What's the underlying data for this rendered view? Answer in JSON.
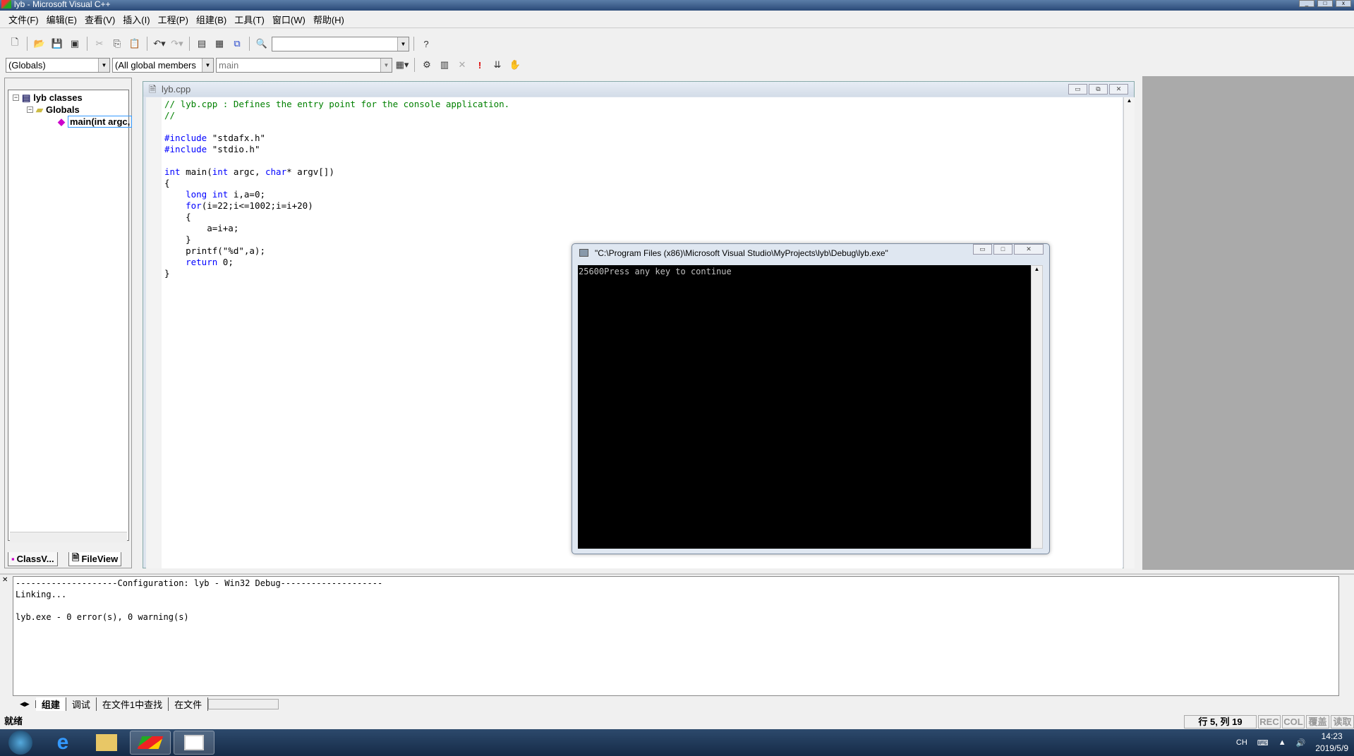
{
  "window": {
    "title": "lyb - Microsoft Visual C++"
  },
  "menu": [
    "文件(F)",
    "编辑(E)",
    "查看(V)",
    "插入(I)",
    "工程(P)",
    "组建(B)",
    "工具(T)",
    "窗口(W)",
    "帮助(H)"
  ],
  "toolbar": {
    "find_combo_value": ""
  },
  "wizardbar": {
    "class_combo": "(Globals)",
    "filter_combo": "(All global members",
    "members_combo": "main"
  },
  "workspace": {
    "tree": [
      {
        "label": "lyb classes",
        "icon": "classes-icon"
      },
      {
        "label": "Globals",
        "icon": "folder-icon"
      },
      {
        "label": "main(int argc,",
        "icon": "function-icon"
      }
    ],
    "tabs": [
      "ClassV...",
      "FileView"
    ]
  },
  "editor": {
    "title": "lyb.cpp",
    "lines": [
      [
        {
          "t": "// lyb.cpp : Defines the entry point for the console application.",
          "c": "cm"
        }
      ],
      [
        {
          "t": "//",
          "c": "cm"
        }
      ],
      [],
      [
        {
          "t": "#include",
          "c": "kw"
        },
        {
          "t": " \"stdafx.h\""
        }
      ],
      [
        {
          "t": "#include",
          "c": "kw"
        },
        {
          "t": " \"stdio.h\""
        }
      ],
      [],
      [
        {
          "t": "int",
          "c": "kw"
        },
        {
          "t": " main("
        },
        {
          "t": "int",
          "c": "kw"
        },
        {
          "t": " argc, "
        },
        {
          "t": "char",
          "c": "kw"
        },
        {
          "t": "* argv[])"
        }
      ],
      [
        {
          "t": "{"
        }
      ],
      [
        {
          "t": "    "
        },
        {
          "t": "long int",
          "c": "kw"
        },
        {
          "t": " i,a=0;"
        }
      ],
      [
        {
          "t": "    "
        },
        {
          "t": "for",
          "c": "kw"
        },
        {
          "t": "(i=22;i<=1002;i=i+20)"
        }
      ],
      [
        {
          "t": "    {"
        }
      ],
      [
        {
          "t": "        a=i+a;"
        }
      ],
      [
        {
          "t": "    }"
        }
      ],
      [
        {
          "t": "    printf(\"%d\",a);"
        }
      ],
      [
        {
          "t": "    "
        },
        {
          "t": "return",
          "c": "kw"
        },
        {
          "t": " 0;"
        }
      ],
      [
        {
          "t": "}"
        }
      ]
    ]
  },
  "console": {
    "title": "\"C:\\Program Files (x86)\\Microsoft Visual Studio\\MyProjects\\lyb\\Debug\\lyb.exe\"",
    "output": "25600Press any key to continue"
  },
  "output": {
    "lines": [
      "--------------------Configuration: lyb - Win32 Debug--------------------",
      "Linking...",
      "",
      "lyb.exe - 0 error(s), 0 warning(s)"
    ],
    "tabs": [
      "组建",
      "调试",
      "在文件1中查找",
      "在文件"
    ]
  },
  "statusbar": {
    "status": "就绪",
    "position": "行 5, 列 19",
    "indicators": [
      "REC",
      "COL",
      "覆盖",
      "读取"
    ]
  },
  "taskbar": {
    "items": [
      "start-button",
      "internet-explorer",
      "file-explorer",
      "visual-cpp",
      "console-window"
    ],
    "tray": {
      "lang": "CH",
      "time": "14:23",
      "date": "2019/5/9"
    }
  }
}
